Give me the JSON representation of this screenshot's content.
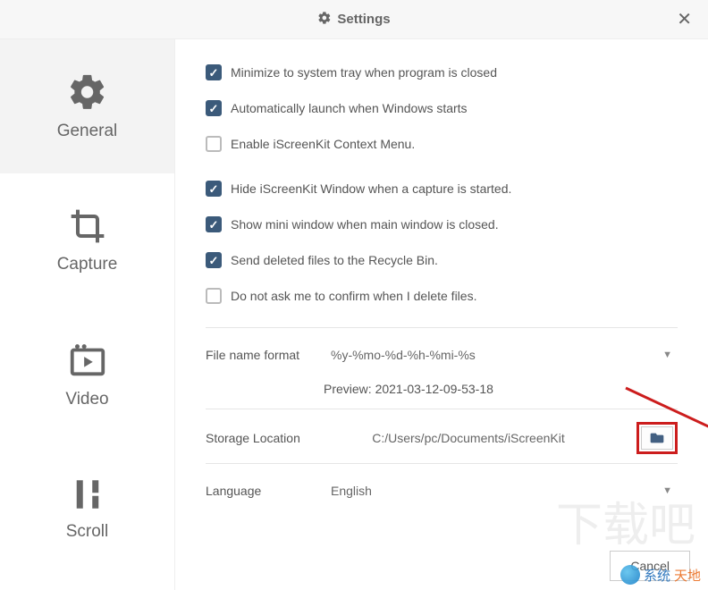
{
  "title": "Settings",
  "sidebar": {
    "items": [
      {
        "label": "General"
      },
      {
        "label": "Capture"
      },
      {
        "label": "Video"
      },
      {
        "label": "Scroll"
      }
    ]
  },
  "options": {
    "minimize_tray": "Minimize to system tray when program is closed",
    "auto_launch": "Automatically launch when Windows starts",
    "context_menu": "Enable iScreenKit Context Menu.",
    "hide_window": "Hide iScreenKit Window when a capture is started.",
    "show_mini": "Show mini window when main window is closed.",
    "recycle_bin": "Send deleted files to the Recycle Bin.",
    "no_confirm_delete": "Do not ask me to confirm when I delete files."
  },
  "filename": {
    "label": "File name format",
    "value": "%y-%mo-%d-%h-%mi-%s",
    "preview_label": "Preview:",
    "preview_value": "2021-03-12-09-53-18"
  },
  "storage": {
    "label": "Storage Location",
    "value": "C:/Users/pc/Documents/iScreenKit"
  },
  "language": {
    "label": "Language",
    "value": "English"
  },
  "footer": {
    "cancel": "Cancel"
  },
  "watermark": {
    "text_a": "系统",
    "text_b": "天地"
  }
}
